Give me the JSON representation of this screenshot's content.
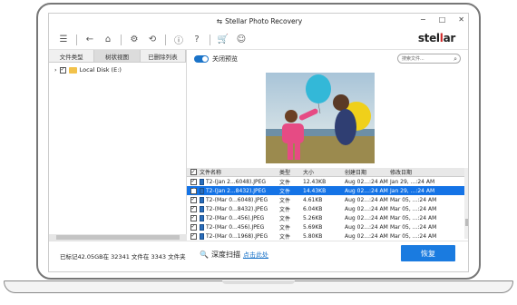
{
  "window": {
    "title": "Stellar Photo Recovery",
    "minimize": "−",
    "maximize": "□",
    "close": "✕"
  },
  "brand": {
    "logo_pre": "stel",
    "logo_accent": "l",
    "logo_post": "ar",
    "accent_color": "#d02828"
  },
  "toolbar": {
    "icons": [
      "menu-icon",
      "back-icon",
      "home-icon",
      "settings-icon",
      "history-icon",
      "info-icon",
      "help-icon",
      "cart-icon",
      "account-icon"
    ]
  },
  "left_panel": {
    "tabs": [
      "文件类型",
      "树状视图",
      "已删除列表"
    ],
    "active_tab": 1,
    "tree": {
      "label": "Local Disk (E:)",
      "checked": true
    }
  },
  "preview": {
    "toggle_label": "关闭预览",
    "toggle_on": true,
    "search_placeholder": "搜索文件..."
  },
  "table": {
    "headers": [
      "文件名称",
      "类型",
      "大小",
      "创建日期",
      "修改日期"
    ],
    "rows": [
      {
        "name": "T2-(Jan 2...6048).JPEG",
        "type": "文件",
        "size": "12.43KB",
        "created": "Aug 02...:24 AM",
        "modified": "Jan 29, ...:24 AM",
        "selected": false
      },
      {
        "name": "T2-(Jan 2...8432).JPEG",
        "type": "文件",
        "size": "14.43KB",
        "created": "Aug 02...:24 AM",
        "modified": "Jan 29, ...:24 AM",
        "selected": true
      },
      {
        "name": "T2-(Mar 0...6048).JPEG",
        "type": "文件",
        "size": "4.61KB",
        "created": "Aug 02...:24 AM",
        "modified": "Mar 05, ...:24 AM",
        "selected": false
      },
      {
        "name": "T2-(Mar 0...8432).JPEG",
        "type": "文件",
        "size": "6.04KB",
        "created": "Aug 02...:24 AM",
        "modified": "Mar 05, ...:24 AM",
        "selected": false
      },
      {
        "name": "T2-(Mar 0...456).JPEG",
        "type": "文件",
        "size": "5.26KB",
        "created": "Aug 02...:24 AM",
        "modified": "Mar 05, ...:24 AM",
        "selected": false
      },
      {
        "name": "T2-(Mar 0...456).JPEG",
        "type": "文件",
        "size": "5.69KB",
        "created": "Aug 02...:24 AM",
        "modified": "Mar 05, ...:24 AM",
        "selected": false
      },
      {
        "name": "T2-(Mar 0...1968).JPEG",
        "type": "文件",
        "size": "5.80KB",
        "created": "Aug 02...:24 AM",
        "modified": "Mar 05, ...:24 AM",
        "selected": false
      }
    ]
  },
  "bottom": {
    "status": "已标记42.05GB在 32341 文件在 3343 文件夹",
    "deep_scan": "深度扫描",
    "deep_scan_link": "点击此处",
    "recover_button": "恢复",
    "button_color": "#1a7be0"
  }
}
